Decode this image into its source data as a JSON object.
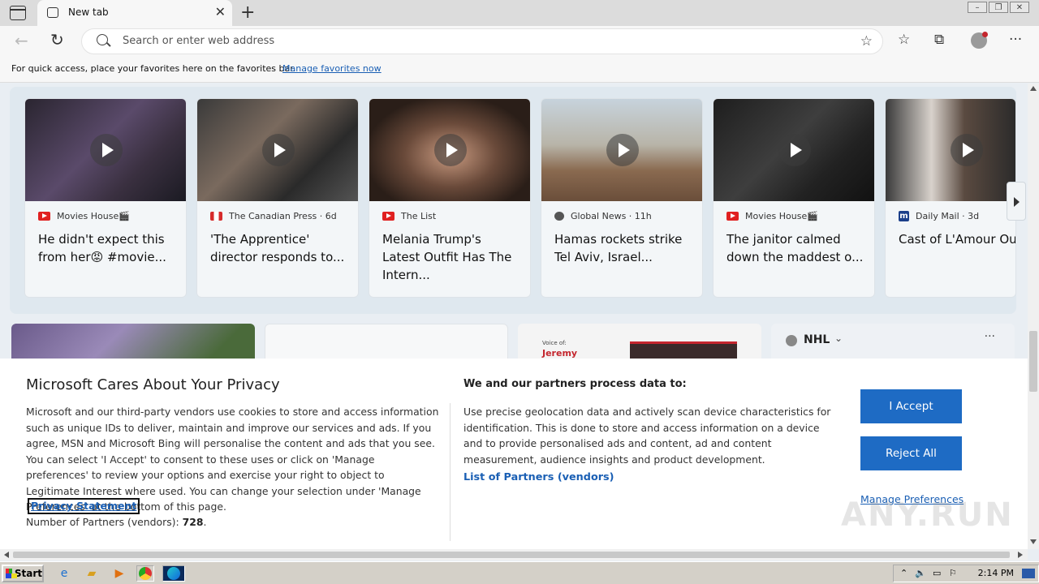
{
  "tab": {
    "title": "New tab"
  },
  "address": {
    "placeholder": "Search or enter web address"
  },
  "favorites_bar": {
    "text": "For quick access, place your favorites here on the favorites bar.",
    "link": "Manage favorites now"
  },
  "cards": [
    {
      "source": "Movies House🎬",
      "title": "He didn't expect this from her😡 #movie...",
      "icon": "youtube-icon"
    },
    {
      "source": "The Canadian Press · 6d",
      "title": "'The Apprentice' director responds to...",
      "icon": "canada-flag-icon"
    },
    {
      "source": "The List",
      "title": "Melania Trump's Latest Outfit Has The Intern...",
      "icon": "youtube-icon"
    },
    {
      "source": "Global News · 11h",
      "title": "Hamas rockets strike Tel Aviv, Israel...",
      "icon": "global-news-icon"
    },
    {
      "source": "Movies House🎬",
      "title": "The janitor calmed down the maddest o...",
      "icon": "youtube-icon"
    },
    {
      "source": "Daily Mail · 3d",
      "title": "Cast of L'Amour Ou... and host of celebs c...",
      "icon": "daily-mail-icon"
    }
  ],
  "tiles": {
    "nhl": "NHL",
    "voice_label": "Voice of:",
    "voice_name": "Jeremy"
  },
  "privacy": {
    "title": "Microsoft Cares About Your Privacy",
    "body": "Microsoft and our third-party vendors use cookies to store and access information such as unique IDs to deliver, maintain and improve our services and ads. If you agree, MSN and Microsoft Bing will personalise the content and ads that you see. You can select 'I Accept' to consent to these uses or click on 'Manage preferences' to review your options and exercise your right to object to Legitimate Interest where used.  You can change your selection under 'Manage Preferences' at the bottom of this page.",
    "statement_link": "Privacy Statement",
    "partners_count_label": "Number of Partners (vendors):",
    "partners_count": "728",
    "subheading": "We and our partners process data to:",
    "purposes": "Use precise geolocation data and actively scan device characteristics for identification. This is done to store and access information on a device and to provide personalised ads and content, ad and content measurement, audience insights and product development.",
    "partners_link": "List of Partners (vendors)",
    "accept": "I Accept",
    "reject": "Reject All",
    "manage": "Manage Preferences"
  },
  "watermark": "ANY.RUN",
  "taskbar": {
    "start": "Start",
    "time": "2:14 PM"
  },
  "colors": {
    "accent": "#1e6bc4",
    "link": "#1a5fb4"
  }
}
